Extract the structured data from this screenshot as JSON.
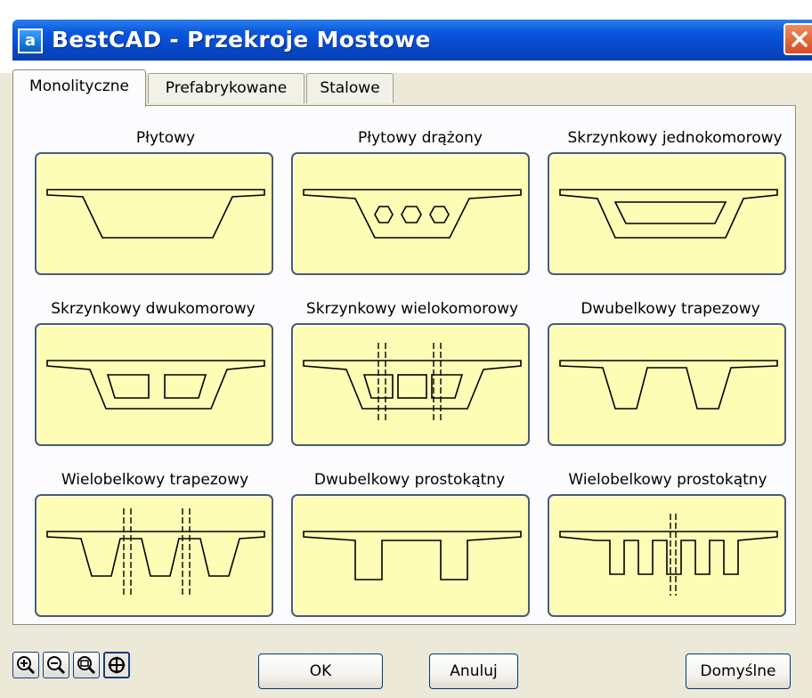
{
  "window": {
    "title": "BestCAD - Przekroje Mostowe",
    "icon": "app-icon",
    "app_icon_glyph": "a"
  },
  "tabs": [
    {
      "label": "Monolityczne",
      "active": true
    },
    {
      "label": "Prefabrykowane",
      "active": false
    },
    {
      "label": "Stalowe",
      "active": false
    }
  ],
  "sections": [
    {
      "label": "Płytowy"
    },
    {
      "label": "Płytowy drążony"
    },
    {
      "label": "Skrzynkowy jednokomorowy"
    },
    {
      "label": "Skrzynkowy dwukomorowy"
    },
    {
      "label": "Skrzynkowy wielokomorowy"
    },
    {
      "label": "Dwubelkowy trapezowy"
    },
    {
      "label": "Wielobelkowy trapezowy"
    },
    {
      "label": "Dwubelkowy prostokątny"
    },
    {
      "label": "Wielobelkowy prostokątny"
    }
  ],
  "zoom_tools": [
    {
      "name": "zoom-in-icon"
    },
    {
      "name": "zoom-out-icon"
    },
    {
      "name": "zoom-window-icon"
    },
    {
      "name": "pan-icon",
      "pressed": true
    }
  ],
  "buttons": {
    "ok": "OK",
    "cancel": "Anuluj",
    "defaults": "Domyślne"
  },
  "colors": {
    "titlebar": "#0548c9",
    "thumbnail_bg": "#fefdb5",
    "close_button": "#d64b21"
  }
}
